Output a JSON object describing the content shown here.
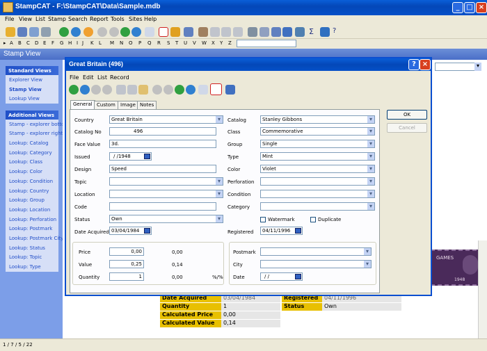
{
  "app": {
    "title": "StampCAT - F:\\StampCAT\\Data\\Sample.mdb"
  },
  "menu": [
    "File",
    "View",
    "List",
    "Stamp",
    "Search",
    "Report",
    "Tools",
    "Sites",
    "Help"
  ],
  "alphabet": [
    "A",
    "B",
    "C",
    "D",
    "E",
    "F",
    "G",
    "H",
    "I",
    "J",
    "K",
    "L",
    "M",
    "N",
    "O",
    "P",
    "Q",
    "R",
    "S",
    "T",
    "U",
    "V",
    "W",
    "X",
    "Y",
    "Z"
  ],
  "view_title": "Stamp View",
  "sidebar": {
    "standard_title": "Standard Views",
    "standard_items": [
      "Explorer View",
      "Stamp View",
      "Lookup View"
    ],
    "additional_title": "Additional Views",
    "additional_items": [
      "Stamp - explorer bottom",
      "Stamp - explorer right",
      "Lookup: Catalog",
      "Lookup: Category",
      "Lookup: Class",
      "Lookup: Color",
      "Lookup: Condition",
      "Lookup: Country",
      "Lookup: Group",
      "Lookup: Location",
      "Lookup: Perforation",
      "Lookup: Postmark",
      "Lookup: Postmark City",
      "Lookup: Status",
      "Lookup: Topic",
      "Lookup: Type"
    ]
  },
  "status": "1 / 7 / 5 / 22",
  "dialog": {
    "title": "Great Britain (496)",
    "menu": [
      "File",
      "Edit",
      "List",
      "Record"
    ],
    "tabs": [
      "General",
      "Custom",
      "Image",
      "Notes"
    ],
    "ok": "OK",
    "cancel": "Cancel",
    "labels": {
      "country": "Country",
      "catalog_no": "Catalog No",
      "face_value": "Face Value",
      "issued": "Issued",
      "design": "Design",
      "topic": "Topic",
      "location": "Location",
      "code": "Code",
      "status": "Status",
      "date_acquired": "Date Acquired",
      "catalog": "Catalog",
      "class": "Class",
      "group": "Group",
      "type": "Type",
      "color": "Color",
      "perforation": "Perforation",
      "condition": "Condition",
      "category": "Category",
      "watermark": "Watermark",
      "duplicate": "Duplicate",
      "registered": "Registered",
      "price": "Price",
      "value": "Value",
      "quantity": "Quantity",
      "postmark": "Postmark",
      "city": "City",
      "date": "Date"
    },
    "values": {
      "country": "Great Britain",
      "catalog_no": "496",
      "face_value": "3d.",
      "issued": "/ /1948",
      "design": "Speed",
      "topic": "",
      "location": "",
      "code": "",
      "status": "Own",
      "date_acquired": "03/04/1984",
      "catalog": "Stanley Gibbons",
      "class": "Commemorative",
      "group": "Single",
      "type": "Mint",
      "color": "Violet",
      "perforation": "",
      "condition": "",
      "category": "",
      "registered": "04/11/1996",
      "price": "0,00",
      "price_total": "0,00",
      "value": "0,25",
      "value_total": "0,14",
      "quantity": "1",
      "quantity_total": "0,00",
      "percent": "%/%",
      "postmark": "",
      "city": "",
      "date": "/ /"
    }
  },
  "background_record": {
    "rows": [
      {
        "label": "Date Acquired",
        "value": "03/04/1984",
        "label2": "Registered",
        "value2": "04/11/1996"
      },
      {
        "label": "Quantity",
        "value": "1",
        "label2": "Status",
        "value2": "Own"
      },
      {
        "label": "Calculated Price",
        "value": "0,00"
      },
      {
        "label": "Calculated Value",
        "value": "0,14"
      }
    ],
    "stamp_text": "GAMES",
    "stamp_year": "1948"
  }
}
